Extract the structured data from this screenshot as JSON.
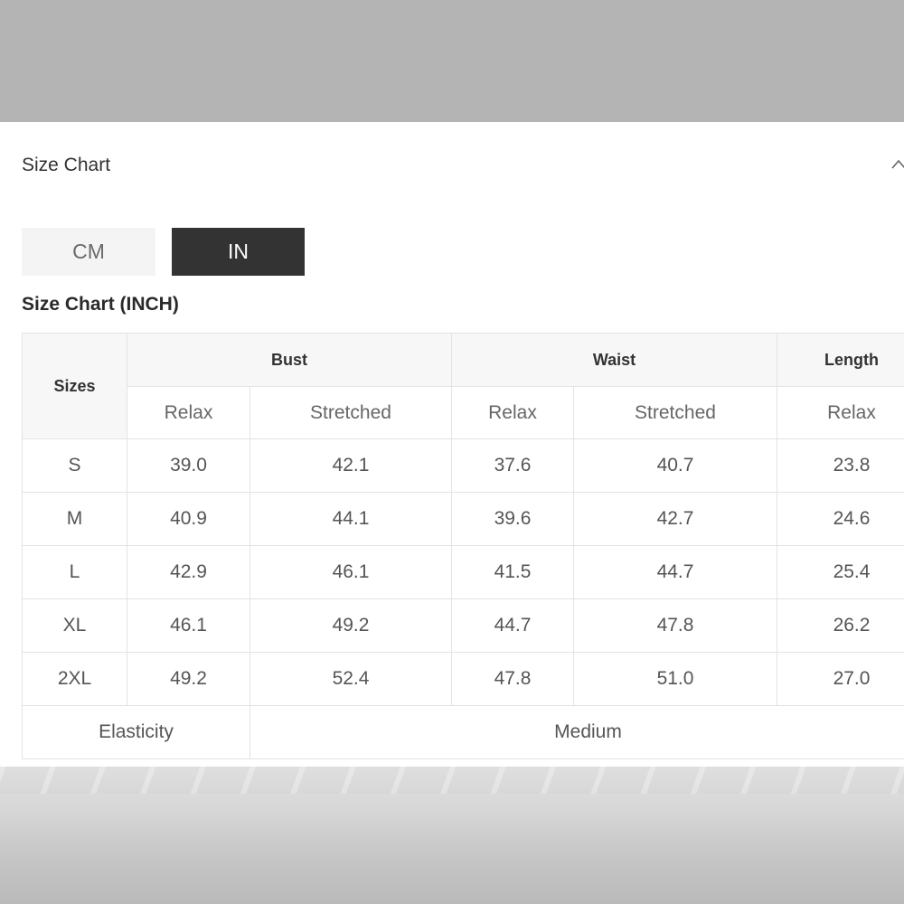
{
  "panel": {
    "title": "Size Chart",
    "collapse_icon": "chevron-up-icon"
  },
  "units": {
    "cm_label": "CM",
    "in_label": "IN",
    "selected": "IN"
  },
  "table": {
    "title": "Size Chart (INCH)",
    "sizes_header": "Sizes",
    "groups": [
      "Bust",
      "Waist",
      "Length"
    ],
    "subheaders": [
      "Relax",
      "Stretched",
      "Relax",
      "Stretched",
      "Relax"
    ],
    "rows": [
      {
        "size": "S",
        "values": [
          "39.0",
          "42.1",
          "37.6",
          "40.7",
          "23.8"
        ]
      },
      {
        "size": "M",
        "values": [
          "40.9",
          "44.1",
          "39.6",
          "42.7",
          "24.6"
        ]
      },
      {
        "size": "L",
        "values": [
          "42.9",
          "46.1",
          "41.5",
          "44.7",
          "25.4"
        ]
      },
      {
        "size": "XL",
        "values": [
          "46.1",
          "49.2",
          "44.7",
          "47.8",
          "26.2"
        ]
      },
      {
        "size": "2XL",
        "values": [
          "49.2",
          "52.4",
          "47.8",
          "51.0",
          "27.0"
        ]
      }
    ],
    "elasticity_label": "Elasticity",
    "elasticity_value": "Medium"
  },
  "colors": {
    "selected_toggle": "#333333",
    "unselected_toggle": "#f4f4f4",
    "header_bg": "#f7f7f7",
    "border": "#e3e3e3"
  }
}
